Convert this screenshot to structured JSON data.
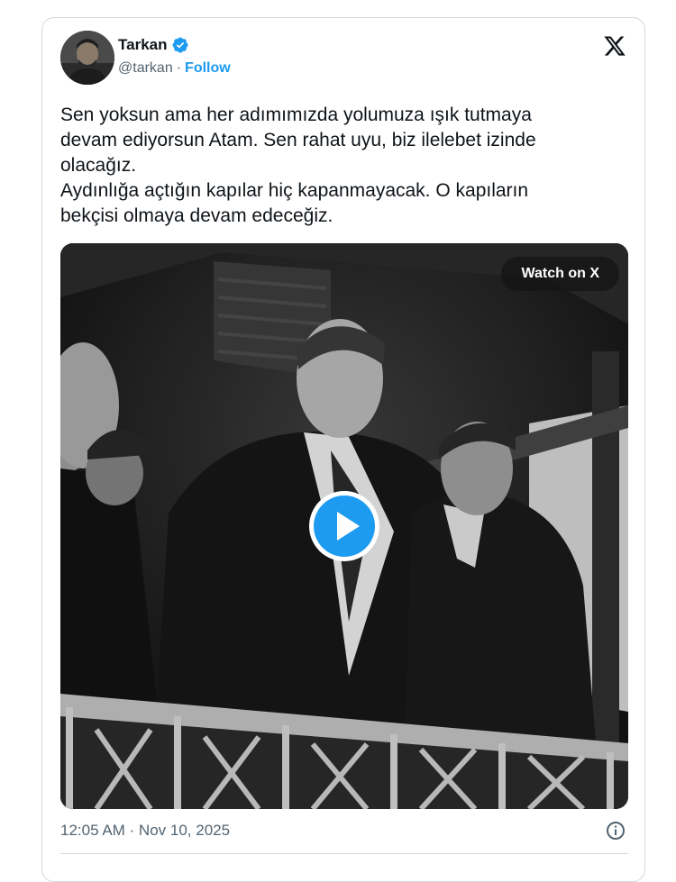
{
  "author": {
    "display_name": "Tarkan",
    "handle": "@tarkan",
    "separator": "·",
    "follow_label": "Follow",
    "verified": true,
    "verified_color": "#1d9bf0"
  },
  "tweet": {
    "text": "Sen yoksun ama her adımımızda yolumuza ışık tutmaya\ndevam ediyorsun Atam. Sen rahat uyu, biz ilelebet izinde\nolacağız.\nAydınlığa açtığın kapılar hiç kapanmayacak. O kapıların\nbekçisi olmaya devam edeceğiz.",
    "timestamp": "12:05 AM · Nov 10, 2025"
  },
  "media": {
    "type": "video",
    "watch_label": "Watch on X",
    "play_icon": "play-icon",
    "play_color": "#1d9bf0"
  },
  "icons": {
    "brand": "x-logo-icon",
    "info": "info-icon"
  }
}
